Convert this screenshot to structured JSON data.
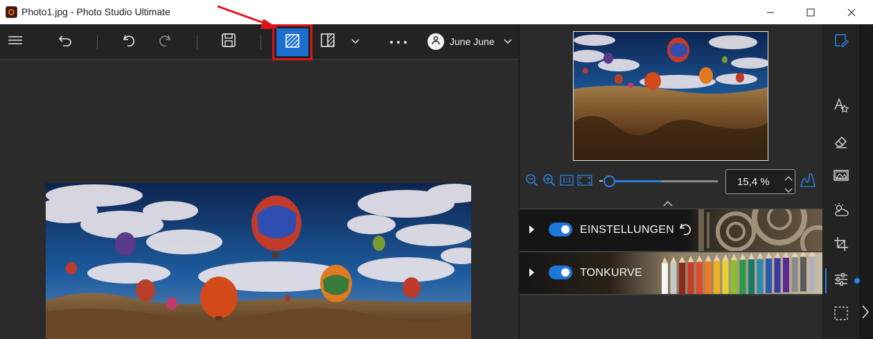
{
  "window": {
    "title": "Photo1.jpg - Photo Studio Ultimate",
    "minimize_icon": "minimize-icon",
    "maximize_icon": "maximize-icon",
    "close_icon": "close-icon"
  },
  "toolbar": {
    "menu_icon": "hamburger-menu-icon",
    "back_icon": "back-arrow-icon",
    "undo_icon": "undo-icon",
    "redo_icon": "redo-icon",
    "save_icon": "save-icon",
    "compare_icon": "before-after-compare-icon",
    "split_view_icon": "split-view-icon",
    "more_icon": "more-options-icon",
    "user_name": "June June",
    "accent_color": "#1c6fd0",
    "highlight_color": "#e0151b"
  },
  "zoom": {
    "value": "15,4 %",
    "slider_level": 0.5,
    "icons": [
      "zoom-out-icon",
      "zoom-in-icon",
      "actual-size-icon",
      "fit-to-screen-icon",
      "histogram-icon"
    ]
  },
  "panels": {
    "sections": [
      {
        "label": "EINSTELLUNGEN",
        "enabled": true,
        "has_reset": true
      },
      {
        "label": "TONKURVE",
        "enabled": true,
        "has_reset": false
      }
    ]
  },
  "sidebar": {
    "icons": [
      "edit-icon",
      "text-effects-icon",
      "eraser-icon",
      "frames-icon",
      "weather-effects-icon",
      "crop-icon",
      "adjustments-icon",
      "selection-icon"
    ],
    "active_index": 6
  }
}
